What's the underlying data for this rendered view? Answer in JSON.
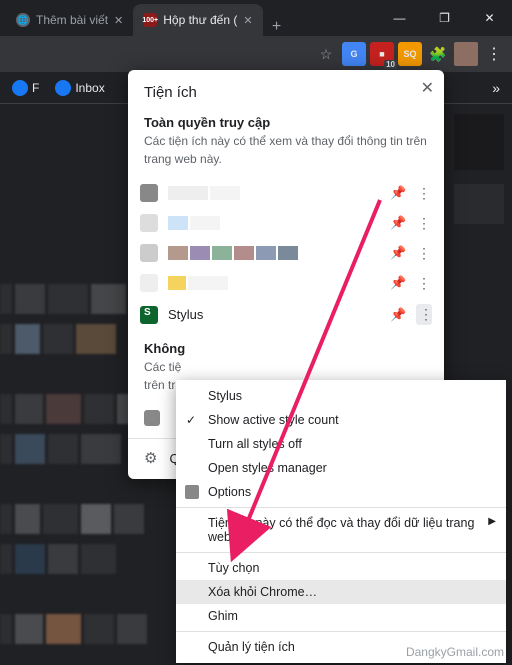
{
  "tabs": {
    "items": [
      {
        "title": "Thêm bài viết",
        "favicon": "globe"
      },
      {
        "title": "Hộp thư đến (",
        "favicon": "gmail",
        "active": true
      }
    ]
  },
  "window_buttons": {
    "min": "—",
    "max": "❐",
    "close": "✕"
  },
  "toolbar": {
    "badge_count": "10"
  },
  "bookmarks": {
    "items": [
      {
        "label": "F"
      },
      {
        "label": "Inbox"
      }
    ],
    "more": "»"
  },
  "ext_popup": {
    "title": "Tiện ích",
    "close": "✕",
    "full_access_title": "Toàn quyền truy cập",
    "full_access_sub": "Các tiện ích này có thể xem và thay đổi thông tin trên trang web này.",
    "named_row": {
      "name": "Stylus"
    },
    "no_access_title": "Không",
    "no_access_sub": "Các tiệ",
    "no_access_sub2": "trên tra",
    "footer_q": "Q"
  },
  "ctx_menu": {
    "items": [
      {
        "label": "Stylus",
        "type": "header"
      },
      {
        "label": "Show active style count",
        "checked": true
      },
      {
        "label": "Turn all styles off"
      },
      {
        "label": "Open styles manager"
      },
      {
        "label": "Options"
      },
      {
        "label": "Tiện ích này có thể đọc và thay đổi dữ liệu trang web",
        "submenu": true
      },
      {
        "label": "Tùy chọn"
      },
      {
        "label": "Xóa khỏi Chrome…",
        "highlighted": true
      },
      {
        "label": "Ghim"
      },
      {
        "label": "Quản lý tiện ích"
      }
    ]
  },
  "watermark": "DangkyGmail.com"
}
